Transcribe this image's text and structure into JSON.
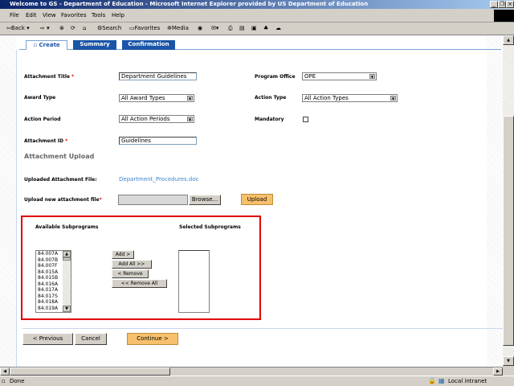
{
  "window": {
    "title": "Welcome to GS - Department of Education - Microsoft Internet Explorer provided by US Department of Education"
  },
  "menu": [
    "File",
    "Edit",
    "View",
    "Favorites",
    "Tools",
    "Help"
  ],
  "toolbar": {
    "back": "Back",
    "search": "Search",
    "favorites": "Favorites",
    "media": "Media"
  },
  "tabs": [
    {
      "label": "Create",
      "active": true
    },
    {
      "label": "Summary"
    },
    {
      "label": "Confirmation"
    }
  ],
  "form": {
    "attachment_title": {
      "label": "Attachment Title",
      "value": "Department Guidelines"
    },
    "award_type": {
      "label": "Award Type",
      "value": "All Award Types"
    },
    "action_period": {
      "label": "Action Period",
      "value": "All Action Periods"
    },
    "attachment_id": {
      "label": "Attachment ID",
      "value": "Guidelines"
    },
    "program_office": {
      "label": "Program Office",
      "value": "OPE"
    },
    "action_type": {
      "label": "Action Type",
      "value": "All Action Types"
    },
    "mandatory": {
      "label": "Mandatory",
      "checked": false
    },
    "required_mark": "*"
  },
  "upload": {
    "heading": "Attachment Upload",
    "uploaded_label": "Uploaded Attachment File:",
    "uploaded_file": "Department_Procedures.doc",
    "new_label": "Upload new attachment file",
    "browse": "Browse...",
    "upload_btn": "Upload"
  },
  "subprograms": {
    "available_label": "Available Subprograms",
    "selected_label": "Selected Subprograms",
    "available": [
      "84.007A",
      "84.007B",
      "84.007F",
      "84.015A",
      "84.015B",
      "84.016A",
      "84.017A",
      "84.017S",
      "84.018A",
      "84.019A"
    ],
    "add": "Add >",
    "add_all": "Add All >>",
    "remove": "< Remove",
    "remove_all": "<< Remove All"
  },
  "nav": {
    "previous": "< Previous",
    "cancel": "Cancel",
    "continue": "Continue >"
  },
  "status": {
    "text": "Done",
    "zone": "Local intranet"
  },
  "colors": {
    "tab_active": "#ffffff",
    "tab": "#1a55a8",
    "highlight_border": "#e00000",
    "orange": "#f7c06c"
  }
}
